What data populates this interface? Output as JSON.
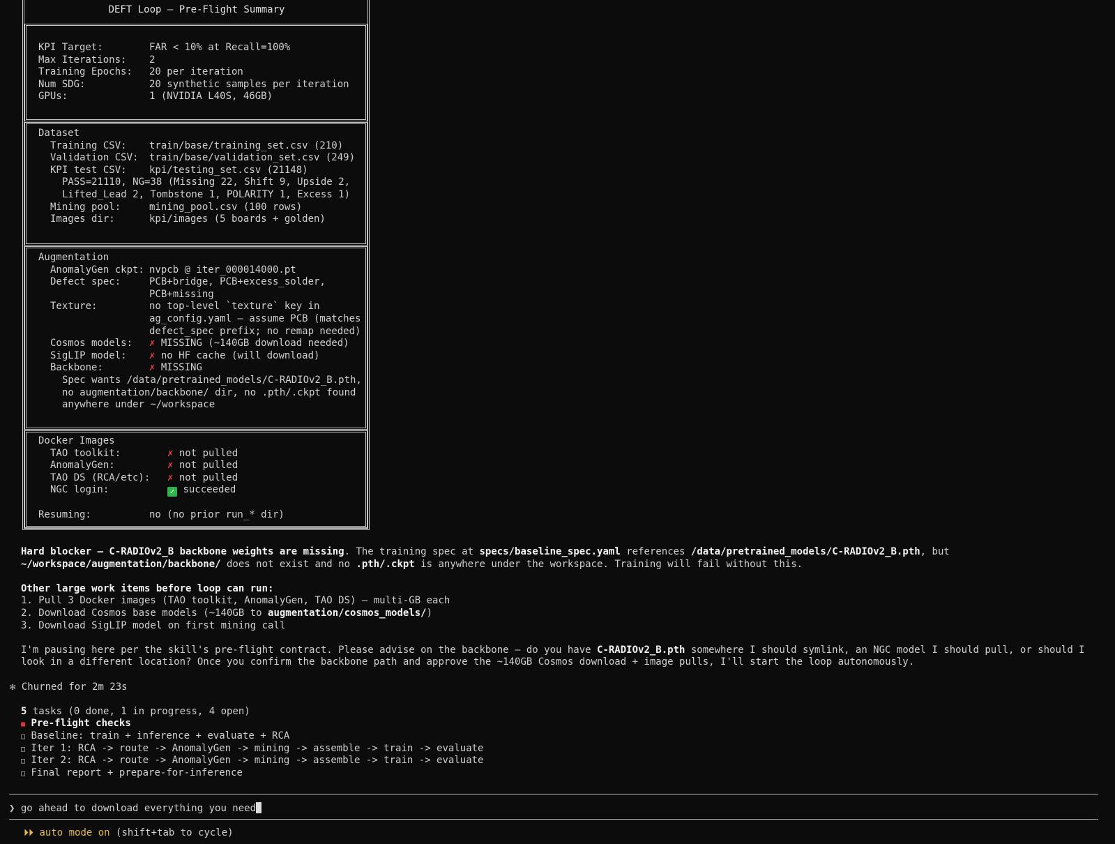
{
  "summary": {
    "title": "DEFT Loop — Pre-Flight Summary",
    "kpi": [
      {
        "k": "KPI Target:",
        "v": "FAR < 10% at Recall=100%"
      },
      {
        "k": "Max Iterations:",
        "v": "2"
      },
      {
        "k": "Training Epochs:",
        "v": "20 per iteration"
      },
      {
        "k": "Num SDG:",
        "v": "20 synthetic samples per iteration"
      },
      {
        "k": "GPUs:",
        "v": "1 (NVIDIA L40S, 46GB)"
      }
    ],
    "dataset": {
      "heading": "Dataset",
      "training_k": "Training CSV:",
      "training_v": "train/base/training_set.csv (210)",
      "validation_k": "Validation CSV:",
      "validation_v": "train/base/validation_set.csv (249)",
      "kpi_k": "KPI test CSV:",
      "kpi_v": "kpi/testing_set.csv (21148)",
      "kpi_detail_1": "PASS=21110, NG=38 (Missing 22, Shift 9, Upside 2,",
      "kpi_detail_2": "Lifted_Lead 2, Tombstone 1, POLARITY 1, Excess 1)",
      "mining_k": "Mining pool:",
      "mining_v": "mining_pool.csv (100 rows)",
      "images_k": "Images dir:",
      "images_v": "kpi/images (5 boards + golden)"
    },
    "augmentation": {
      "heading": "Augmentation",
      "ckpt_k": "AnomalyGen ckpt:",
      "ckpt_v": "nvpcb @ iter_000014000.pt",
      "defect_k": "Defect spec:",
      "defect_v1": "PCB+bridge, PCB+excess_solder,",
      "defect_v2": "PCB+missing",
      "texture_k": "Texture:",
      "texture_v1": "no top-level `texture` key in",
      "texture_v2": "ag_config.yaml — assume PCB (matches",
      "texture_v3": "defect_spec prefix; no remap needed)",
      "cosmos_k": "Cosmos models:",
      "cosmos_v": "MISSING (~140GB download needed)",
      "siglip_k": "SigLIP model:",
      "siglip_v": "no HF cache (will download)",
      "backbone_k": "Backbone:",
      "backbone_v": "MISSING",
      "backbone_note_1": "Spec wants /data/pretrained_models/C-RADIOv2_B.pth,",
      "backbone_note_2": "no augmentation/backbone/ dir, no .pth/.ckpt found",
      "backbone_note_3": "anywhere under ~/workspace"
    },
    "docker": {
      "heading": "Docker Images",
      "tao_k": "TAO toolkit:",
      "tao_v": "not pulled",
      "ag_k": "AnomalyGen:",
      "ag_v": "not pulled",
      "ds_k": "TAO DS (RCA/etc):",
      "ds_v": "not pulled",
      "ngc_k": "NGC login:",
      "ngc_v": "succeeded",
      "resume_k": "Resuming:",
      "resume_v": "no (no prior run_* dir)"
    }
  },
  "message": {
    "blocker_bold": "Hard blocker — C-RADIOv2_B backbone weights are missing",
    "blocker_t1": ". The training spec at ",
    "blocker_b2": "specs/baseline_spec.yaml",
    "blocker_t2": " references ",
    "blocker_b3": "/data/pretrained_models/C-RADIOv2_B.pth",
    "blocker_t3": ", but",
    "line2_b1": "~/workspace/augmentation/backbone/",
    "line2_t1": " does not exist and no ",
    "line2_b2": ".pth/.ckpt",
    "line2_t2": " is anywhere under the workspace. Training will fail without this.",
    "other_heading": "Other large work items before loop can run:",
    "item1": "1. Pull 3 Docker images (TAO toolkit, AnomalyGen, TAO DS) — multi-GB each",
    "item2_a": "2. Download Cosmos base models (~140GB to ",
    "item2_b": "augmentation/cosmos_models/",
    "item2_c": ")",
    "item3": "3. Download SigLIP model on first mining call",
    "pause_a": "I'm pausing here per the skill's pre-flight contract. Please advise on the backbone — do you have ",
    "pause_b": "C-RADIOv2_B.pth",
    "pause_c": " somewhere I should symlink, an NGC model I should pull, or should I",
    "pause_2": "look in a different location? Once you confirm the backbone path and approve the ~140GB Cosmos download + image pulls, I'll start the loop autonomously."
  },
  "status": {
    "churned": "Churned for 2m 23s",
    "tasks_count": "5",
    "tasks_rest": " tasks (0 done, 1 in progress, 4 open)",
    "tasks": [
      "Pre-flight checks",
      "Baseline: train + inference + evaluate + RCA",
      "Iter 1: RCA -> route -> AnomalyGen -> mining -> assemble -> train -> evaluate",
      "Iter 2: RCA -> route -> AnomalyGen -> mining -> assemble -> train -> evaluate",
      "Final report + prepare-for-inference"
    ]
  },
  "prompt": {
    "symbol": "❯",
    "value": "go ahead to download everything you need"
  },
  "footer": {
    "mode_label": "auto mode on",
    "mode_hint": " (shift+tab to cycle)"
  },
  "icons": {
    "cross": "✗",
    "check": "✓",
    "spinner": "✻",
    "task_active": "■",
    "task_open": "□",
    "mode": "⏵⏵"
  },
  "colors": {
    "background": "#0c0c0c",
    "cross": "#e8434b",
    "check": "#2fb34a",
    "active_task": "#e0323c"
  }
}
